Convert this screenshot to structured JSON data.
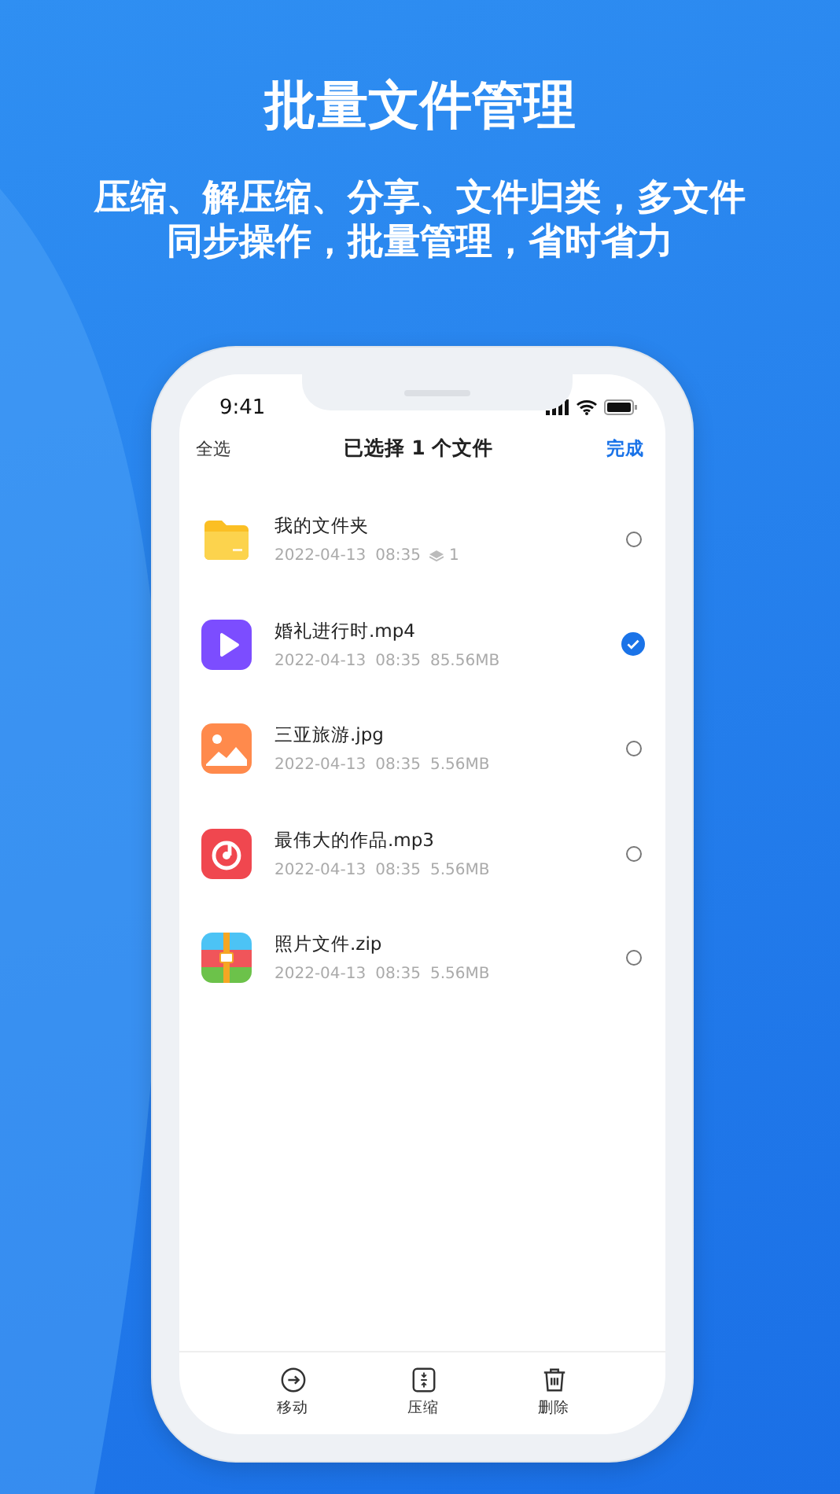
{
  "headline": "批量文件管理",
  "subtitle_lines": [
    "压缩、解压缩、分享、文件归类，多文件",
    "同步操作，批量管理，省时省力"
  ],
  "status_bar": {
    "time": "9:41"
  },
  "nav": {
    "left": "全选",
    "title": "已选择 1 个文件",
    "right": "完成"
  },
  "files": [
    {
      "kind": "folder",
      "name": "我的文件夹",
      "date": "2022-04-13",
      "time": "08:35",
      "extra": "1",
      "selected": false
    },
    {
      "kind": "video",
      "name": "婚礼进行时.mp4",
      "date": "2022-04-13",
      "time": "08:35",
      "extra": "85.56MB",
      "selected": true
    },
    {
      "kind": "image",
      "name": "三亚旅游.jpg",
      "date": "2022-04-13",
      "time": "08:35",
      "extra": "5.56MB",
      "selected": false
    },
    {
      "kind": "audio",
      "name": "最伟大的作品.mp3",
      "date": "2022-04-13",
      "time": "08:35",
      "extra": "5.56MB",
      "selected": false
    },
    {
      "kind": "archive",
      "name": "照片文件.zip",
      "date": "2022-04-13",
      "time": "08:35",
      "extra": "5.56MB",
      "selected": false
    }
  ],
  "toolbar": [
    {
      "kind": "move",
      "label": "移动"
    },
    {
      "kind": "compress",
      "label": "压缩"
    },
    {
      "kind": "delete",
      "label": "删除"
    }
  ]
}
